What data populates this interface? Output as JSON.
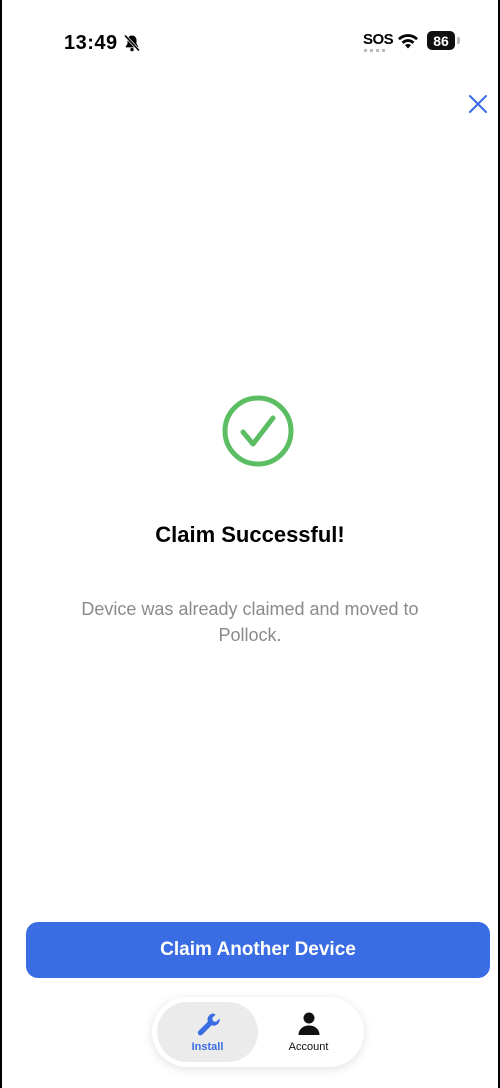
{
  "status_bar": {
    "time": "13:49",
    "carrier_status": "SOS",
    "battery_level": "86",
    "icons": [
      "bell-slash-icon",
      "wifi-icon",
      "battery-icon"
    ]
  },
  "header": {
    "close_icon": "close-icon"
  },
  "success": {
    "icon": "check-circle-icon",
    "title": "Claim Successful!",
    "message": "Device was already claimed and moved to Pollock."
  },
  "actions": {
    "primary_label": "Claim Another Device"
  },
  "tab_bar": {
    "tabs": [
      {
        "label": "Install",
        "icon": "wrench-icon",
        "active": true
      },
      {
        "label": "Account",
        "icon": "person-icon",
        "active": false
      }
    ]
  },
  "colors": {
    "accent": "#3a6de3",
    "success": "#5cbe63",
    "muted_text": "#8a8a8a"
  }
}
